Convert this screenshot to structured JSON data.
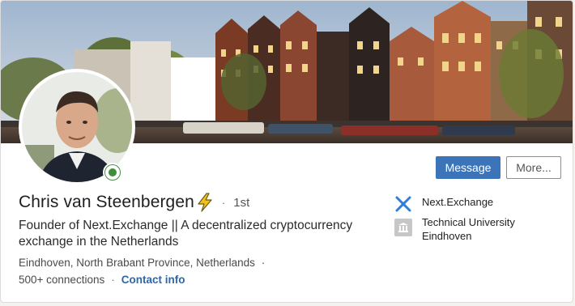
{
  "profile": {
    "name": "Chris van Steenbergen",
    "degree": "1st",
    "degree_separator": "·",
    "headline": "Founder of Next.Exchange || A decentralized cryptocurrency exchange in the Netherlands",
    "location": "Eindhoven, North Brabant Province, Netherlands",
    "location_separator": "·",
    "connections": "500+ connections",
    "connections_separator": "·",
    "contact_info": "Contact info"
  },
  "actions": {
    "message_label": "Message",
    "more_label": "More..."
  },
  "sidebar": {
    "company": {
      "name": "Next.Exchange",
      "icon": "next-exchange-logo-icon"
    },
    "school": {
      "name_line1": "Technical University",
      "name_line2": "Eindhoven",
      "icon": "school-icon"
    }
  },
  "colors": {
    "accent": "#3b74b8",
    "link": "#2a67b1",
    "online": "#3f8f3a"
  }
}
